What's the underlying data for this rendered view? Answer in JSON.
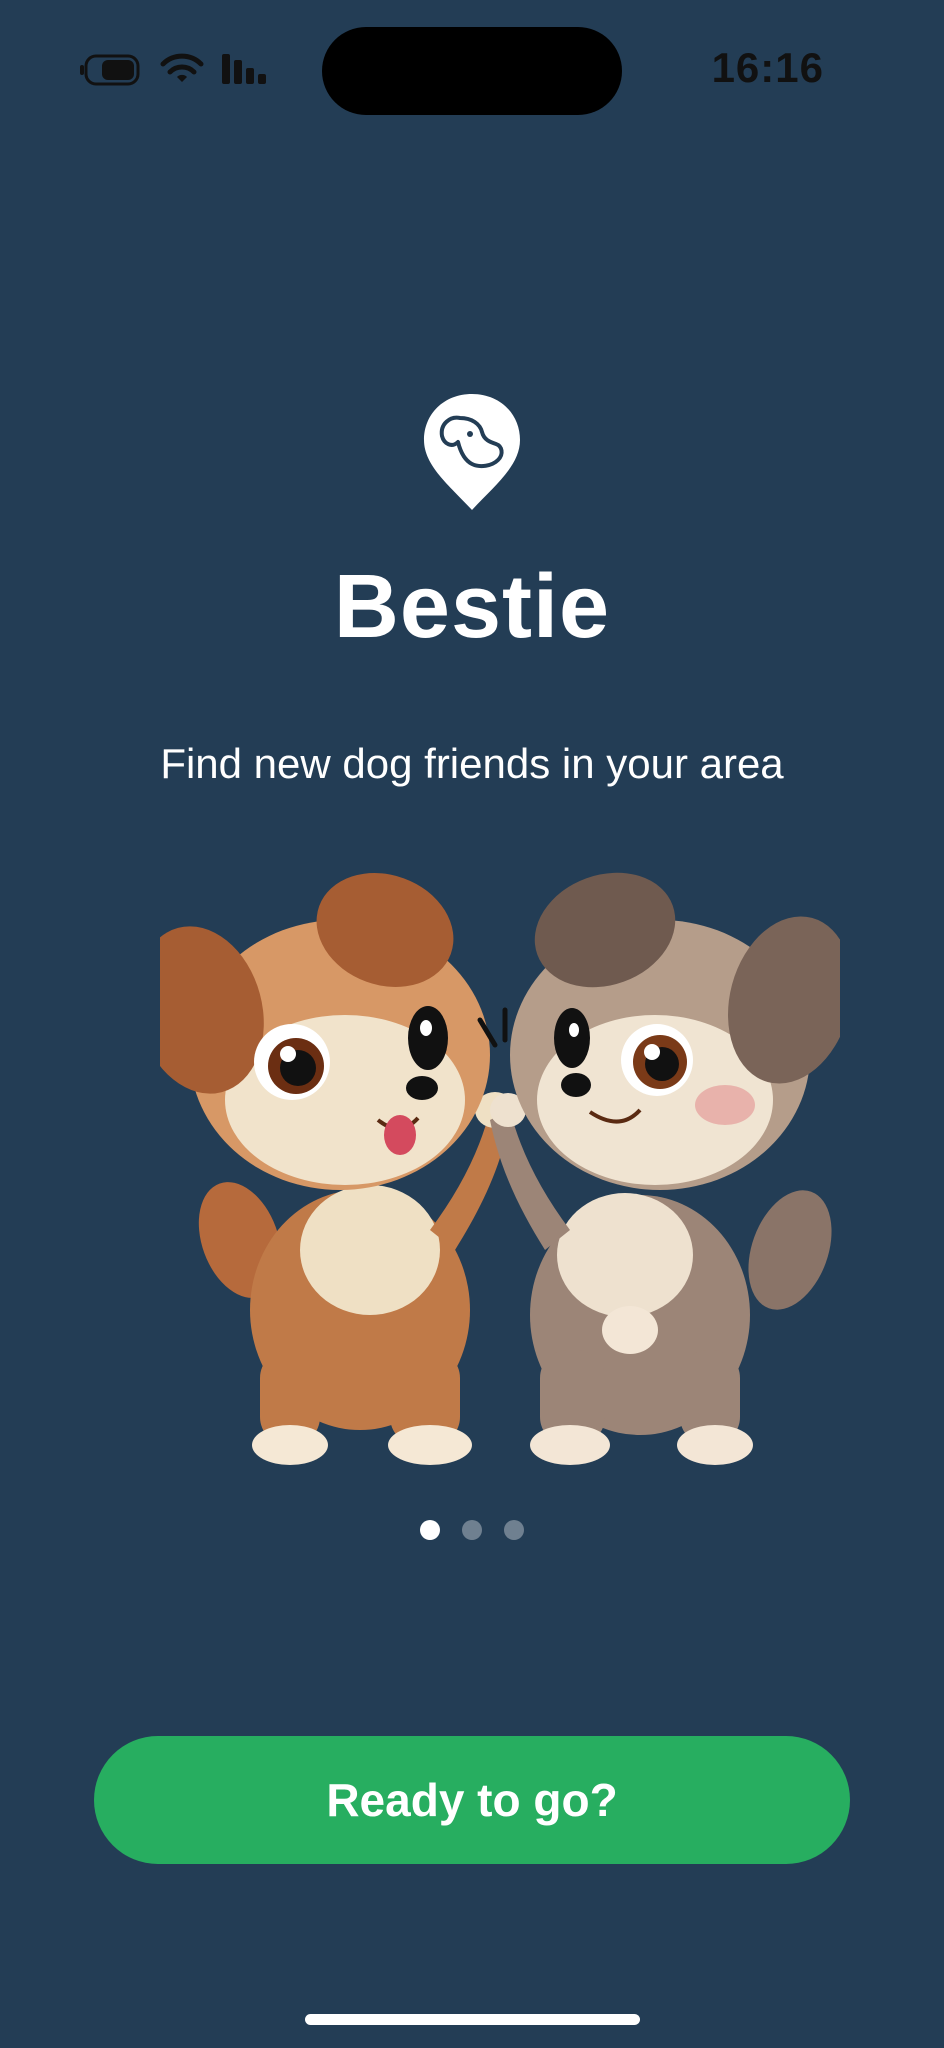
{
  "status_bar": {
    "time": "16:16",
    "icons": [
      "battery-icon",
      "wifi-icon",
      "cellular-signal-icon"
    ]
  },
  "app": {
    "logo_icon": "dog-location-pin-icon",
    "title": "Bestie",
    "tagline": "Find new dog friends in your area"
  },
  "pagination": {
    "total": 3,
    "active": 0
  },
  "cta": {
    "label": "Ready to go?"
  },
  "colors": {
    "background": "#233d55",
    "accent": "#27ae60",
    "text": "#ffffff"
  }
}
